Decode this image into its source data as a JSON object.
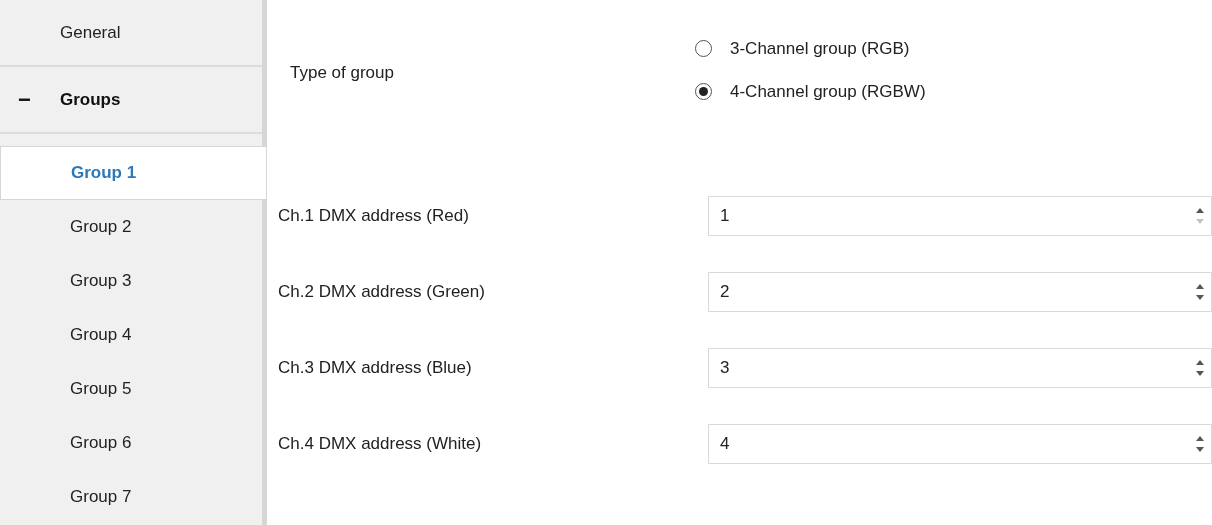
{
  "sidebar": {
    "items": [
      {
        "label": "General",
        "selected": false
      },
      {
        "label": "Groups",
        "selected": false,
        "expanded": true,
        "toggle": "−",
        "children": [
          {
            "label": "Group 1",
            "selected": true
          },
          {
            "label": "Group 2",
            "selected": false
          },
          {
            "label": "Group 3",
            "selected": false
          },
          {
            "label": "Group 4",
            "selected": false
          },
          {
            "label": "Group 5",
            "selected": false
          },
          {
            "label": "Group 6",
            "selected": false
          },
          {
            "label": "Group 7",
            "selected": false
          }
        ]
      }
    ]
  },
  "type_of_group": {
    "label": "Type of group",
    "options": [
      {
        "label": "3-Channel group (RGB)",
        "selected": false
      },
      {
        "label": "4-Channel group (RGBW)",
        "selected": true
      }
    ]
  },
  "fields": [
    {
      "label": "Ch.1 DMX address (Red)",
      "value": "1",
      "at_min": true
    },
    {
      "label": "Ch.2 DMX address (Green)",
      "value": "2",
      "at_min": false
    },
    {
      "label": "Ch.3 DMX address (Blue)",
      "value": "3",
      "at_min": false
    },
    {
      "label": "Ch.4 DMX address (White)",
      "value": "4",
      "at_min": false
    }
  ]
}
